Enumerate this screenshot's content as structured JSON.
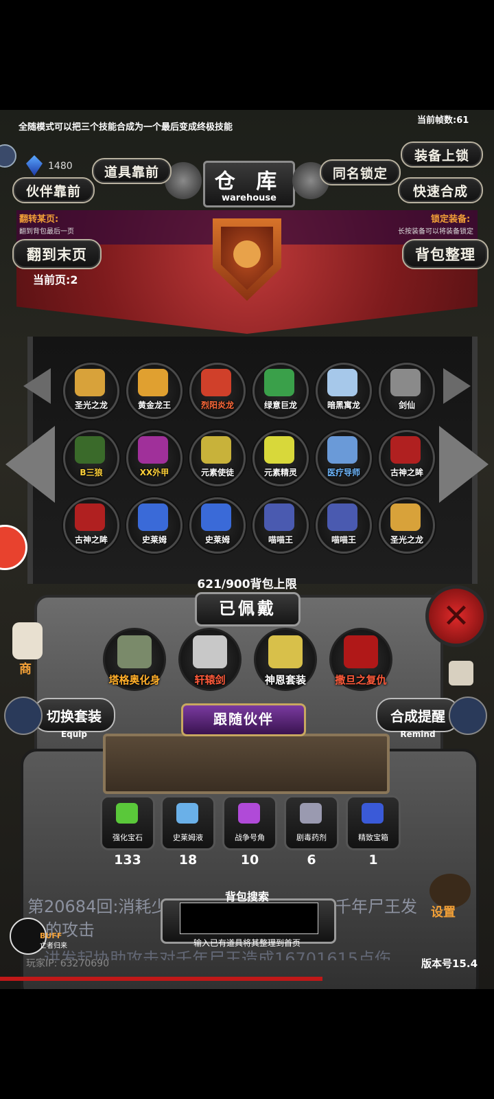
{
  "tip": "全随模式可以把三个技能合成为一个最后变成终极技能",
  "fps": "当前帧数:61",
  "gem_count": "1480",
  "buttons": {
    "item_front": "道具靠前",
    "partner_front": "伙伴靠前",
    "same_name_lock": "同名锁定",
    "equip_lock": "装备上锁",
    "quick_merge": "快速合成",
    "go_last_page": "翻到末页",
    "sort_bag": "背包整理"
  },
  "title": {
    "cn": "仓 库",
    "en": "warehouse"
  },
  "flip_page": {
    "title": "翻转某页:",
    "desc": "翻到背包最后一页"
  },
  "lock_equip": {
    "title": "锁定装备:",
    "desc": "长按装备可以将装备锁定"
  },
  "current_page": "当前页:2",
  "bag_slots": [
    {
      "name": "圣光之龙",
      "color": "#ffffff",
      "art": "#d8a23a"
    },
    {
      "name": "黄金龙王",
      "color": "#ffffff",
      "art": "#e0a030"
    },
    {
      "name": "烈阳炎龙",
      "color": "#ff6a3a",
      "art": "#d0402a"
    },
    {
      "name": "绿意巨龙",
      "color": "#ffffff",
      "art": "#3aa04a"
    },
    {
      "name": "暗黑寓龙",
      "color": "#ffffff",
      "art": "#a6c8ea"
    },
    {
      "name": "剑仙",
      "color": "#ffffff",
      "art": "#8a8a8a"
    },
    {
      "name": "B三狼",
      "color": "#ffd23a",
      "art": "#3a6a2a"
    },
    {
      "name": "XX外甲",
      "color": "#ffd23a",
      "art": "#a0309a"
    },
    {
      "name": "元素使徒",
      "color": "#ffffff",
      "art": "#c8b23a"
    },
    {
      "name": "元素精灵",
      "color": "#ffffff",
      "art": "#d8d83a"
    },
    {
      "name": "医疗导师",
      "color": "#6fb8ff",
      "art": "#6a9ad8"
    },
    {
      "name": "古神之眸",
      "color": "#ffffff",
      "art": "#b02020"
    },
    {
      "name": "古神之眸",
      "color": "#ffffff",
      "art": "#b02020"
    },
    {
      "name": "史莱姆",
      "color": "#ffffff",
      "art": "#3a6ad8"
    },
    {
      "name": "史莱姆",
      "color": "#ffffff",
      "art": "#3a6ad8"
    },
    {
      "name": "喵喵王",
      "color": "#ffffff",
      "art": "#4a5ab0"
    },
    {
      "name": "喵喵王",
      "color": "#ffffff",
      "art": "#4a5ab0"
    },
    {
      "name": "圣光之龙",
      "color": "#ffffff",
      "art": "#d8a23a"
    }
  ],
  "bag_limit": "621/900背包上限",
  "equipped_title": "已佩戴",
  "equipped": [
    {
      "name": "塔格奥化身",
      "color": "#ffae2a",
      "art": "#7a8a6a"
    },
    {
      "name": "轩辕剑",
      "color": "#ff5a3a",
      "art": "#c8c8c8"
    },
    {
      "name": "神恩套装",
      "color": "#ffffff",
      "art": "#d8c04a"
    },
    {
      "name": "撒旦之复仇",
      "color": "#ff5a3a",
      "art": "#b01818"
    }
  ],
  "switch_set": {
    "label": "切换套装",
    "sub": "Equip"
  },
  "merge_remind": {
    "label": "合成提醒",
    "sub": "Remind"
  },
  "follow_partner": "跟随伙伴",
  "items": [
    {
      "name": "强化宝石",
      "count": "133",
      "art": "#5ac83a"
    },
    {
      "name": "史莱姆液",
      "count": "18",
      "art": "#6ab0e8"
    },
    {
      "name": "战争号角",
      "count": "10",
      "art": "#b04ad8"
    },
    {
      "name": "剧毒药剂",
      "count": "6",
      "art": "#9a9ab0"
    },
    {
      "name": "精致宝箱",
      "count": "1",
      "art": "#3a5ad8"
    }
  ],
  "scroll_text_1": "第20684回:消耗少",
  "scroll_text_1b": "千年尸王发",
  "scroll_text_2": "的攻击",
  "scroll_text_3": "讲发起协助攻击对千年尸王造成16701615点伤",
  "bag_search": {
    "label": "背包搜索",
    "hint": "输入已有道具将其整理到首页"
  },
  "player_ip": "玩家IP: 63270690",
  "buff": {
    "title": "BUFF",
    "sub": "亡者归来"
  },
  "settings": "设置",
  "shop_partial": "商",
  "version": "版本号15.4"
}
